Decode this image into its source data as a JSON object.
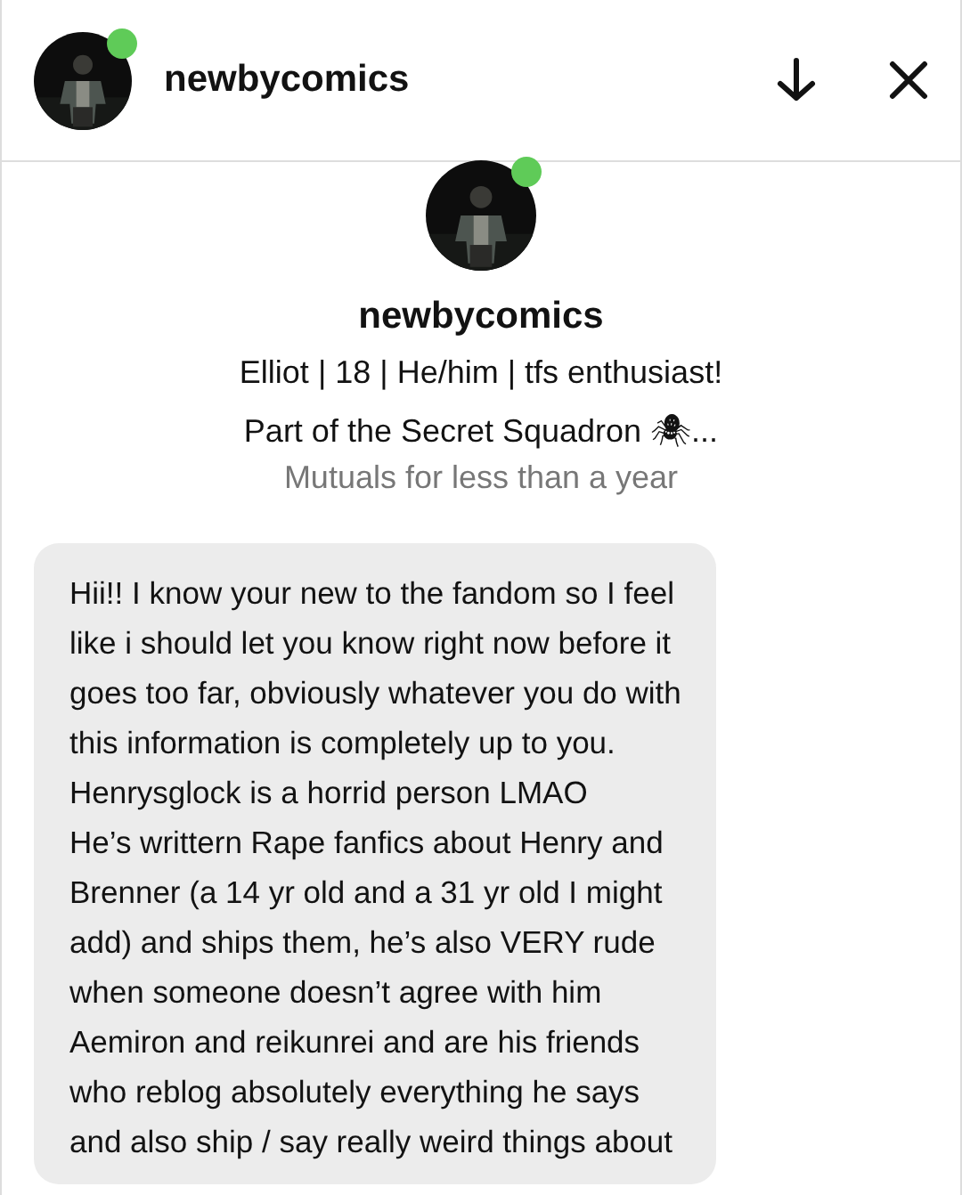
{
  "header": {
    "username": "newbycomics",
    "online": true
  },
  "profile": {
    "username": "newbycomics",
    "online": true,
    "bio": [
      "Elliot | 18 | He/him | tfs enthusiast!",
      "Part of the Secret Squadron 🕷..."
    ],
    "relationship": "Mutuals for less than a year"
  },
  "message": {
    "lines": [
      "Hii!! I know your new to the fandom so I feel",
      "like i should let you know right now before it",
      "goes too far, obviously whatever you do with",
      "this information is completely up to you.",
      "Henrysglock is a horrid person LMAO",
      "He’s writtern Rape fanfics about Henry and",
      "Brenner (a 14 yr old and a 31 yr old I might",
      "add) and ships them, he’s also VERY rude",
      "when someone doesn’t agree with him",
      "Aemiron and reikunrei and are his friends",
      "who reblog absolutely everything he says",
      "and also ship / say really weird things about"
    ]
  }
}
